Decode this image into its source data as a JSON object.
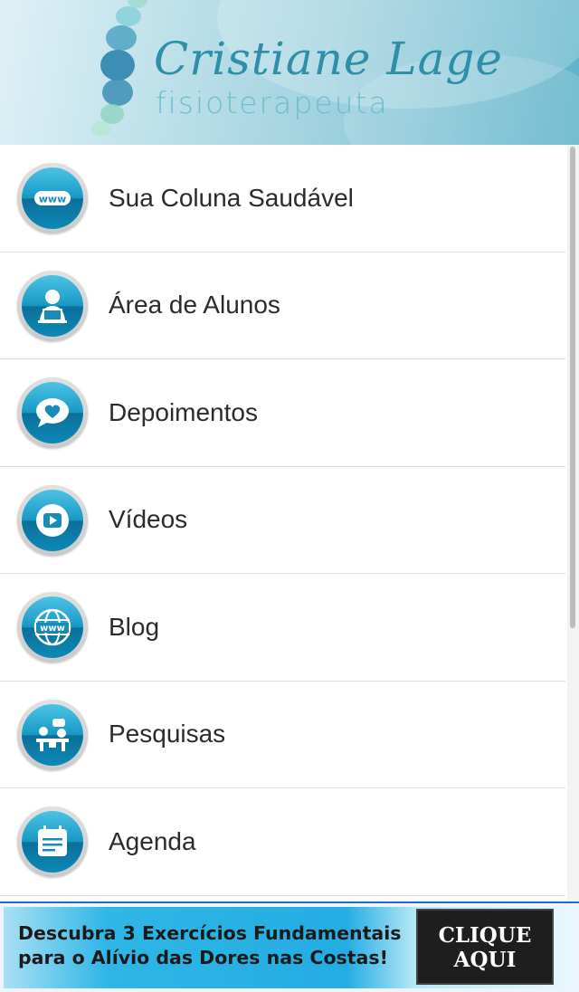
{
  "header": {
    "brand_name": "Cristiane Lage",
    "brand_subtitle": "fisioterapeuta"
  },
  "menu": {
    "items": [
      {
        "label": "Sua Coluna Saudável",
        "icon": "www-icon"
      },
      {
        "label": "Área de Alunos",
        "icon": "student-icon"
      },
      {
        "label": "Depoimentos",
        "icon": "heart-speech-icon"
      },
      {
        "label": "Vídeos",
        "icon": "video-play-icon"
      },
      {
        "label": "Blog",
        "icon": "globe-www-icon"
      },
      {
        "label": "Pesquisas",
        "icon": "survey-icon"
      },
      {
        "label": "Agenda",
        "icon": "calendar-icon"
      }
    ]
  },
  "banner": {
    "line1": "Descubra 3 Exercícios Fundamentais",
    "line2": "para o Alívio das Dores nas Costas!",
    "cta_line1": "CLIQUE",
    "cta_line2": "AQUI"
  },
  "colors": {
    "accent": "#1698c4",
    "header_text": "#2f8ea8",
    "banner_border": "#1f6fc9"
  }
}
